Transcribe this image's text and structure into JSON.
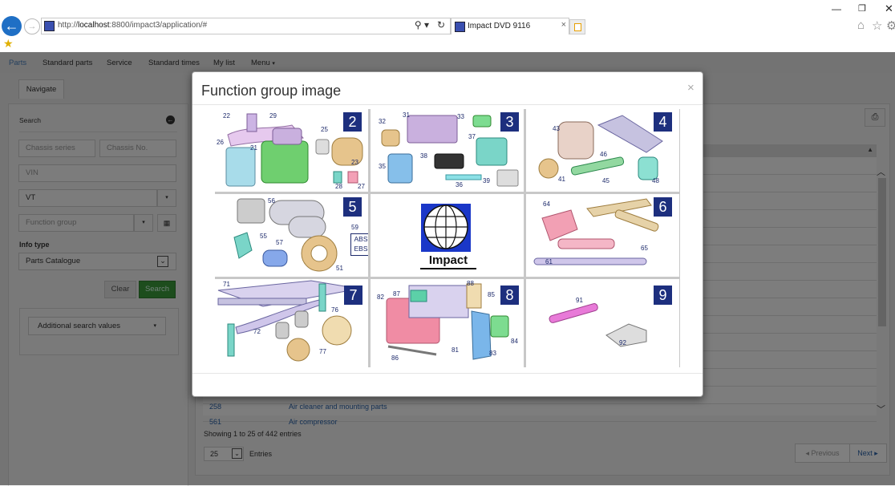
{
  "browser": {
    "url_prefix": "http://",
    "url_host": "localhost",
    "url_rest": ":8800/impact3/application/#",
    "tab_title": "Impact DVD 9116",
    "search_glyph": "⚲ ▾",
    "refresh_glyph": "↻",
    "tab_close": "×"
  },
  "nav": {
    "items": [
      "Parts",
      "Standard parts",
      "Service",
      "Standard times",
      "My list",
      "Menu"
    ],
    "active": "Parts"
  },
  "subtab": {
    "label": "Navigate"
  },
  "sidebar": {
    "title": "Search",
    "chassis_series_placeholder": "Chassis series",
    "chassis_no_placeholder": "Chassis No.",
    "vin_placeholder": "VIN",
    "vehicle_type_value": "VT",
    "function_group_placeholder": "Function group",
    "info_type_label": "Info type",
    "info_type_value": "Parts Catalogue",
    "clear_label": "Clear",
    "search_label": "Search",
    "additional_label": "Additional search values"
  },
  "grid": {
    "rows": [
      {
        "code": "258",
        "description": "Air cleaner and mounting parts"
      },
      {
        "code": "561",
        "description": "Air compressor"
      }
    ],
    "showing_text": "Showing 1 to 25 of 442 entries",
    "page_length": "25",
    "entries_label": "Entries",
    "previous_label": "Previous",
    "next_label": "Next"
  },
  "modal": {
    "title": "Function group image",
    "close": "×",
    "cells": [
      {
        "group": "2",
        "parts": [
          "22",
          "29",
          "25",
          "26",
          "21",
          "23",
          "28",
          "27"
        ]
      },
      {
        "group": "3",
        "parts": [
          "31",
          "33",
          "32",
          "37",
          "35",
          "38",
          "39",
          "36"
        ]
      },
      {
        "group": "4",
        "parts": [
          "43",
          "46",
          "41",
          "45",
          "48"
        ]
      },
      {
        "group": "5",
        "parts": [
          "56",
          "59",
          "55",
          "57",
          "51"
        ],
        "abs_label": "ABS",
        "ebs_label": "EBS"
      },
      {
        "logo_text": "Impact"
      },
      {
        "group": "6",
        "parts": [
          "64",
          "61",
          "65"
        ]
      },
      {
        "group": "7",
        "parts": [
          "71",
          "76",
          "72",
          "77"
        ]
      },
      {
        "group": "8",
        "parts": [
          "82",
          "87",
          "88",
          "85",
          "84",
          "81",
          "83",
          "86"
        ]
      },
      {
        "group": "9",
        "parts": [
          "91",
          "92"
        ]
      }
    ]
  },
  "colors": {
    "badge": "#1d2f7e",
    "search_button": "#3a9a3a",
    "link": "#2a62a8",
    "back_button": "#1f6fc5"
  },
  "icons": [
    "back-arrow-icon",
    "forward-arrow-icon",
    "page-icon",
    "search-icon",
    "refresh-icon",
    "home-icon",
    "star-icon",
    "gear-icon",
    "favorites-icon",
    "print-icon",
    "close-icon",
    "chevron-down-icon",
    "barcode-icon",
    "arrow-circle-icon"
  ]
}
